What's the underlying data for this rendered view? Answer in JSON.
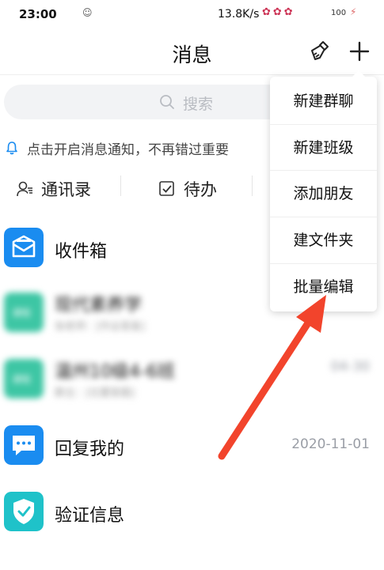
{
  "statusbar": {
    "time": "23:00",
    "speed": "13.8K/s",
    "battery": "100"
  },
  "header": {
    "title": "消息"
  },
  "search": {
    "placeholder": "搜索"
  },
  "notice": {
    "text": "点击开启消息通知，不再错过重要"
  },
  "shortcuts": [
    {
      "label": "通讯录"
    },
    {
      "label": "待办"
    }
  ],
  "list": [
    {
      "title": "收件箱",
      "time": ""
    },
    {
      "title": "现代素养学",
      "sub": "张老师：[作业答复]",
      "time": "",
      "badge": "课程"
    },
    {
      "title": "温州10级4-6班",
      "sub": "群主：[位置答题]",
      "time": "04-30",
      "badge": "课程"
    },
    {
      "title": "回复我的",
      "time": "2020-11-01"
    },
    {
      "title": "验证信息",
      "time": ""
    }
  ],
  "menu": {
    "items": [
      {
        "label": "新建群聊"
      },
      {
        "label": "新建班级"
      },
      {
        "label": "添加朋友"
      },
      {
        "label": "建文件夹"
      },
      {
        "label": "批量编辑"
      }
    ]
  },
  "colors": {
    "accent_blue": "#1a8cf0",
    "green": "#3dc6a4",
    "teal": "#1fc2c9",
    "arrow_red": "#f2442c"
  }
}
